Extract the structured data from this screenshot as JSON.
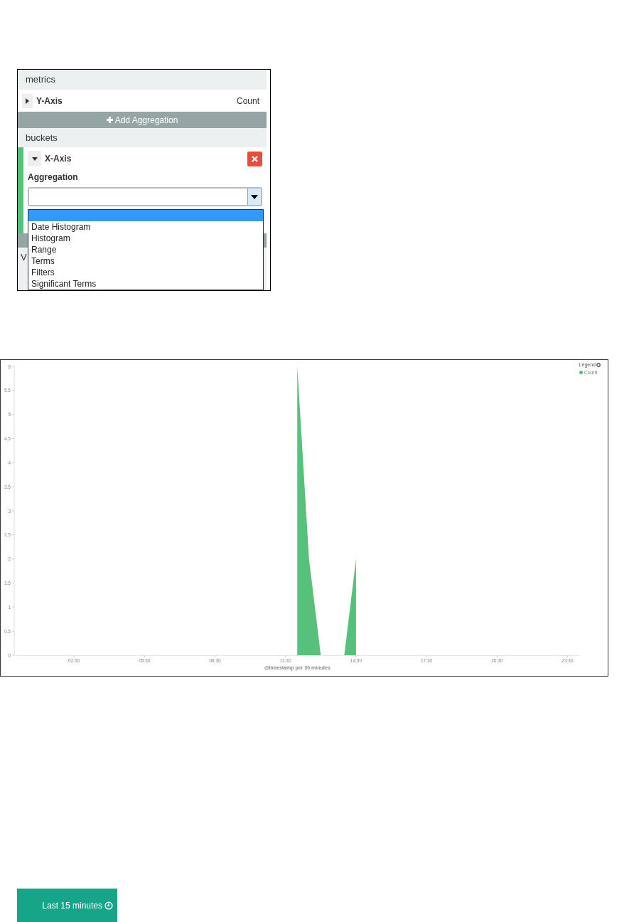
{
  "editor": {
    "metrics_header": "metrics",
    "y_axis": {
      "label": "Y-Axis",
      "value": "Count",
      "expanded": false
    },
    "add_button": "Add Aggregation",
    "buckets_header": "buckets",
    "x_axis": {
      "label": "X-Axis",
      "expanded": true,
      "color": "#57c17b"
    },
    "aggregation_label": "Aggregation",
    "next_section": "V",
    "options": [
      {
        "kind": "blank",
        "selected": true
      },
      {
        "kind": "option",
        "label": "Date Histogram",
        "selected": false
      },
      {
        "kind": "option",
        "label": "Histogram",
        "selected": false
      },
      {
        "kind": "option",
        "label": "Range",
        "selected": false
      },
      {
        "kind": "option",
        "label": "Terms",
        "selected": false
      },
      {
        "kind": "option",
        "label": "Filters",
        "selected": false
      },
      {
        "kind": "option",
        "label": "Significant Terms",
        "selected": false
      }
    ]
  },
  "chart": {
    "chart_data": {
      "type": "area",
      "xlabel": "@timestamp per 30 minutes",
      "xlim": [
        0,
        24
      ],
      "ylim": [
        0,
        6
      ],
      "x": [
        12,
        12.5,
        13,
        14,
        14.5
      ],
      "series": [
        {
          "name": "Count",
          "color": "#57c17b",
          "values": [
            6,
            2,
            0,
            0,
            2
          ]
        }
      ],
      "xticks": [
        {
          "value": 2.5,
          "label": "02:30"
        },
        {
          "value": 5.5,
          "label": "05:30"
        },
        {
          "value": 8.5,
          "label": "08:30"
        },
        {
          "value": 11.5,
          "label": "11:30"
        },
        {
          "value": 14.5,
          "label": "14:30"
        },
        {
          "value": 17.5,
          "label": "17:30"
        },
        {
          "value": 20.5,
          "label": "20:30"
        },
        {
          "value": 23.5,
          "label": "23:30"
        }
      ],
      "yticks": [
        {
          "value": 0,
          "label": "0"
        },
        {
          "value": 0.5,
          "label": "0.5"
        },
        {
          "value": 1,
          "label": "1"
        },
        {
          "value": 1.5,
          "label": "1.5"
        },
        {
          "value": 2,
          "label": "2"
        },
        {
          "value": 2.5,
          "label": "2.5"
        },
        {
          "value": 3,
          "label": "3"
        },
        {
          "value": 3.5,
          "label": "3.5"
        },
        {
          "value": 4,
          "label": "4"
        },
        {
          "value": 4.5,
          "label": "4.5"
        },
        {
          "value": 5,
          "label": "5"
        },
        {
          "value": 5.5,
          "label": "5.5"
        },
        {
          "value": 6,
          "label": "6"
        }
      ]
    },
    "legend_title": "Legend"
  },
  "time_button": "Last 15 minutes"
}
